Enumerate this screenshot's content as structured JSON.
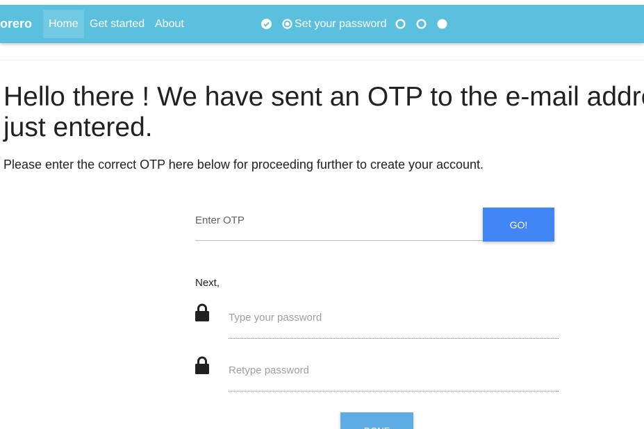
{
  "navbar": {
    "brand": "orero",
    "links": [
      {
        "label": "Home",
        "active": true
      },
      {
        "label": "Get started",
        "active": false
      },
      {
        "label": "About",
        "active": false
      }
    ],
    "steps": {
      "current_label": "Set your password",
      "items": [
        {
          "state": "done",
          "icon": "check-circle-icon"
        },
        {
          "state": "current",
          "icon": "radio-dot-icon"
        },
        {
          "state": "pending",
          "icon": "ring-icon"
        },
        {
          "state": "pending",
          "icon": "ring-icon"
        },
        {
          "state": "pending",
          "icon": "filled-circle-icon"
        }
      ]
    },
    "color": "#5bc0de"
  },
  "main": {
    "heading_line1": "Hello there ! We have sent an OTP to the e-mail address you",
    "heading_line2": "just entered.",
    "subtext": "Please enter the correct OTP here below for proceeding further to create your account."
  },
  "otp": {
    "placeholder": "Enter OTP",
    "value": "",
    "go_label": "GO!",
    "go_color": "#4285f4"
  },
  "password": {
    "next_label": "Next,",
    "password_placeholder": "Type your password",
    "retype_placeholder": "Retype password",
    "done_label": "DONE",
    "lock_icon": "lock-icon"
  }
}
